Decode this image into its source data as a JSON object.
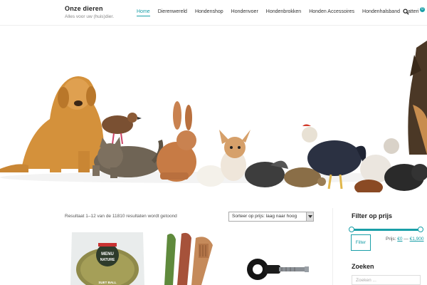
{
  "site": {
    "title": "Onze dieren",
    "tagline": "Alles voor uw (huis)dier."
  },
  "nav": {
    "items": [
      {
        "label": "Home",
        "active": true
      },
      {
        "label": "Dierenwereld"
      },
      {
        "label": "Hondenshop"
      },
      {
        "label": "Hondenvoer"
      },
      {
        "label": "Hondenbrokken"
      },
      {
        "label": "Honden Accessoires"
      },
      {
        "label": "Hondenhalsband"
      }
    ],
    "cart_label": "atteri",
    "cart_count": "0",
    "search_icon": "search-icon"
  },
  "shop": {
    "result_count": "Resultaat 1–12 van de 11810 resultaten wordt getoond",
    "sort_selected": "Sorteer op prijs: laag naar hoog"
  },
  "sidebar": {
    "filter_title": "Filter op prijs",
    "filter_button": "Filter",
    "price_prefix": "Prijs: ",
    "price_min": "€0",
    "price_separator": " — ",
    "price_max": "€1,900",
    "search_title": "Zoeken",
    "search_placeholder": "Zoeken ..."
  },
  "products": [
    {
      "label_top": "MENU",
      "label_bottom": "NATURE",
      "caption": "SUET BALL"
    },
    {
      "name": "wooden brush chew"
    },
    {
      "name": "electric fence insulator"
    }
  ],
  "colors": {
    "accent": "#1a9fa8"
  }
}
